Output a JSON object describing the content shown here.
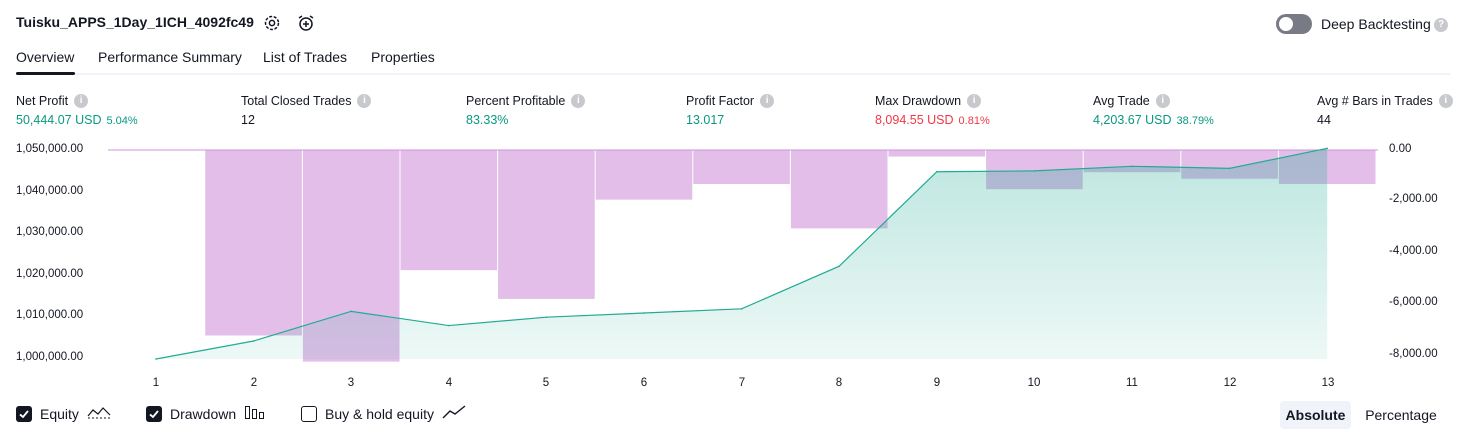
{
  "header": {
    "title": "Tuisku_APPS_1Day_1ICH_4092fc49",
    "deep_backtesting_label": "Deep Backtesting",
    "deep_backtesting_enabled": false
  },
  "tabs": [
    {
      "label": "Overview",
      "active": true
    },
    {
      "label": "Performance Summary",
      "active": false
    },
    {
      "label": "List of Trades",
      "active": false
    },
    {
      "label": "Properties",
      "active": false
    }
  ],
  "metrics": [
    {
      "label": "Net Profit",
      "value": "50,444.07 USD",
      "pct": "5.04%",
      "tone": "green"
    },
    {
      "label": "Total Closed Trades",
      "value": "12",
      "pct": "",
      "tone": "dark"
    },
    {
      "label": "Percent Profitable",
      "value": "83.33%",
      "pct": "",
      "tone": "green"
    },
    {
      "label": "Profit Factor",
      "value": "13.017",
      "pct": "",
      "tone": "green"
    },
    {
      "label": "Max Drawdown",
      "value": "8,094.55 USD",
      "pct": "0.81%",
      "tone": "red"
    },
    {
      "label": "Avg Trade",
      "value": "4,203.67 USD",
      "pct": "38.79%",
      "tone": "green"
    },
    {
      "label": "Avg # Bars in Trades",
      "value": "44",
      "pct": "",
      "tone": "dark"
    }
  ],
  "chart_data": {
    "type": "line",
    "x": [
      1,
      2,
      3,
      4,
      5,
      6,
      7,
      8,
      9,
      10,
      11,
      12,
      13
    ],
    "x_tick_labels": [
      "1",
      "2",
      "3",
      "4",
      "5",
      "6",
      "7",
      "8",
      "9",
      "10",
      "11",
      "12",
      "13"
    ],
    "left_axis": {
      "ylim": [
        1000000,
        1050000
      ],
      "tick_labels": [
        "1,050,000.00",
        "1,040,000.00",
        "1,030,000.00",
        "1,020,000.00",
        "1,010,000.00",
        "1,000,000.00"
      ]
    },
    "right_axis": {
      "ylim": [
        -8000,
        0
      ],
      "tick_labels": [
        "0.00",
        "-2,000.00",
        "-4,000.00",
        "-6,000.00",
        "-8,000.00"
      ]
    },
    "series": [
      {
        "name": "Equity",
        "kind": "area-line",
        "axis": "left",
        "color": "#22ab94",
        "values": [
          1000000,
          1004300,
          1011400,
          1008000,
          1010000,
          1011000,
          1012000,
          1022200,
          1044800,
          1045000,
          1046100,
          1045600,
          1050400
        ]
      },
      {
        "name": "Drawdown",
        "kind": "bar",
        "axis": "right",
        "color": "#ce93d8",
        "values": [
          0,
          -7100,
          -8100,
          -4600,
          -5700,
          -1900,
          -1300,
          -3000,
          -250,
          -1500,
          -850,
          -1100,
          -1300
        ]
      }
    ],
    "grid": false
  },
  "legend": {
    "equity": {
      "label": "Equity",
      "checked": true,
      "icon": "equity-line-icon"
    },
    "drawdown": {
      "label": "Drawdown",
      "checked": true,
      "icon": "drawdown-bars-icon"
    },
    "buy_hold": {
      "label": "Buy & hold equity",
      "checked": false,
      "icon": "buy-hold-line-icon"
    }
  },
  "scale_toggle": {
    "absolute_label": "Absolute",
    "percentage_label": "Percentage",
    "selected": "Absolute"
  }
}
